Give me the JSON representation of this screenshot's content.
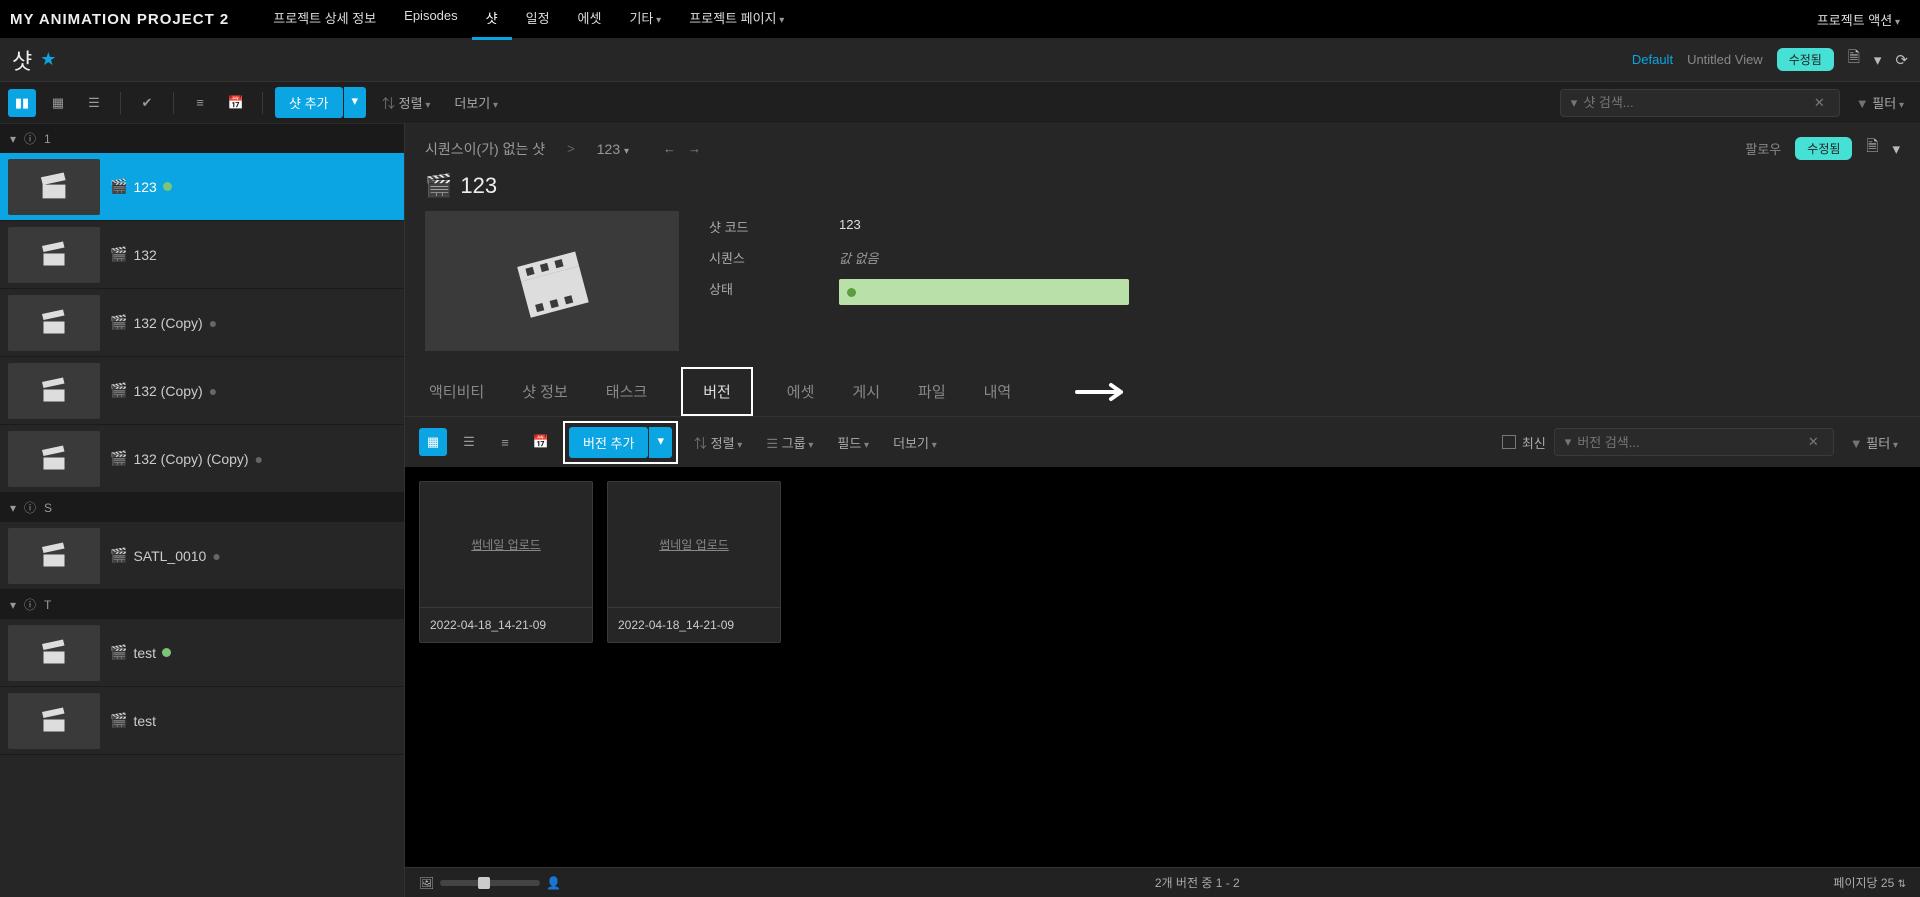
{
  "topbar": {
    "project_title": "MY ANIMATION PROJECT 2",
    "nav": [
      {
        "label": "프로젝트 상세 정보"
      },
      {
        "label": "Episodes"
      },
      {
        "label": "샷",
        "active": true
      },
      {
        "label": "일정"
      },
      {
        "label": "에셋"
      },
      {
        "label": "기타",
        "dd": true
      },
      {
        "label": "프로젝트 페이지",
        "dd": true
      }
    ],
    "right_action": "프로젝트 액션"
  },
  "subbar": {
    "title": "샷",
    "view_default": "Default",
    "view_untitled": "Untitled View",
    "pill": "수정됨"
  },
  "toolbar": {
    "add_button": "샷 추가",
    "sort": "정렬",
    "more": "더보기",
    "search_placeholder": "샷 검색...",
    "filter": "필터"
  },
  "left": {
    "groups": [
      {
        "label": "1",
        "items": [
          {
            "name": "123",
            "selected": true,
            "status": "green"
          },
          {
            "name": "132"
          },
          {
            "name": "132 (Copy)",
            "status_dot": true
          },
          {
            "name": "132 (Copy)",
            "status_dot": true
          },
          {
            "name": "132 (Copy) (Copy)",
            "status_dot": true
          }
        ]
      },
      {
        "label": "S",
        "items": [
          {
            "name": "SATL_0010",
            "status_dot": true
          }
        ]
      },
      {
        "label": "T",
        "items": [
          {
            "name": "test",
            "status": "green"
          },
          {
            "name": "test"
          }
        ]
      }
    ]
  },
  "detail": {
    "breadcrumb_a": "시퀀스이(가) 없는 샷",
    "breadcrumb_b": "123",
    "follow": "팔로우",
    "pill": "수정됨",
    "title": "123",
    "fields": {
      "code_label": "샷 코드",
      "code_value": "123",
      "seq_label": "시퀀스",
      "seq_value": "값 없음",
      "status_label": "상태"
    },
    "tabs": [
      {
        "label": "액티비티"
      },
      {
        "label": "샷 정보"
      },
      {
        "label": "태스크"
      },
      {
        "label": "버전",
        "highlighted": true
      },
      {
        "label": "에셋"
      },
      {
        "label": "게시"
      },
      {
        "label": "파일"
      },
      {
        "label": "내역"
      }
    ],
    "vtoolbar": {
      "add": "버전 추가",
      "sort": "정렬",
      "group": "그룹",
      "field": "필드",
      "more": "더보기",
      "recent": "최신",
      "search_placeholder": "버전 검색...",
      "filter": "필터"
    },
    "versions": [
      {
        "thumb_label": "썸네일 업로드",
        "name": "2022-04-18_14-21-09"
      },
      {
        "thumb_label": "썸네일 업로드",
        "name": "2022-04-18_14-21-09"
      }
    ],
    "footer": {
      "count_text": "2개 버전 중 1 - 2",
      "per_page": "페이지당 25"
    }
  }
}
